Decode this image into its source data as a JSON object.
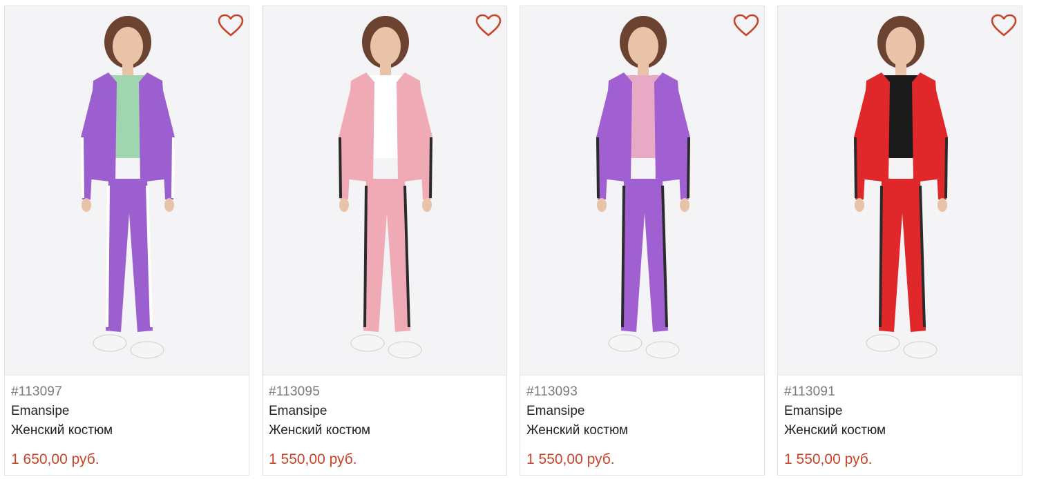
{
  "products": [
    {
      "sku": "#113097",
      "brand": "Emansipe",
      "title": "Женский костюм",
      "price": "1 650,00 руб.",
      "colors": {
        "jacket": "#9b5fd0",
        "pants": "#9b5fd0",
        "top": "#9fd6b0",
        "stripe": "#ffffff"
      }
    },
    {
      "sku": "#113095",
      "brand": "Emansipe",
      "title": "Женский костюм",
      "price": "1 550,00 руб.",
      "colors": {
        "jacket": "#f0aab6",
        "pants": "#f0aab6",
        "top": "#ffffff",
        "stripe": "#2b2b2b"
      }
    },
    {
      "sku": "#113093",
      "brand": "Emansipe",
      "title": "Женский костюм",
      "price": "1 550,00 руб.",
      "colors": {
        "jacket": "#a160d2",
        "pants": "#a160d2",
        "top": "#e8a9c4",
        "stripe": "#2b2b2b"
      }
    },
    {
      "sku": "#113091",
      "brand": "Emansipe",
      "title": "Женский костюм",
      "price": "1 550,00 руб.",
      "colors": {
        "jacket": "#e0282b",
        "pants": "#e0282b",
        "top": "#1a1a1a",
        "stripe": "#2b2b2b"
      }
    }
  ],
  "icons": {
    "favorite": "heart-outline-icon"
  },
  "accent_color": "#c8442a"
}
